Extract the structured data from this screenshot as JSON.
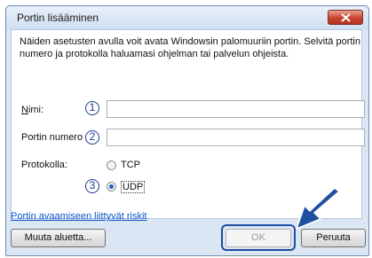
{
  "window": {
    "title": "Portin lisääminen",
    "intro": "Näiden asetusten avulla voit avata Windowsin palomuuriin portin. Selvitä portin numero ja protokolla haluamasi ohjelman tai palvelun ohjeista."
  },
  "form": {
    "name_label": "Nimi:",
    "name_value": "",
    "port_label": "Portin numero",
    "port_value": "",
    "protocol_label": "Protokolla:",
    "protocols": [
      {
        "label": "TCP",
        "selected": false
      },
      {
        "label": "UDP",
        "selected": true
      }
    ]
  },
  "callouts": [
    "1",
    "2",
    "3"
  ],
  "link": "Portin avaamiseen liittyvät riskit",
  "buttons": {
    "change_scope": "Muuta aluetta...",
    "ok": "OK",
    "cancel": "Peruuta"
  },
  "colors": {
    "annotation": "#1a3a8c",
    "link": "#0b53c9",
    "close_button": "#c7462f"
  },
  "icons": [
    "close-icon",
    "pointer-arrow-icon"
  ]
}
